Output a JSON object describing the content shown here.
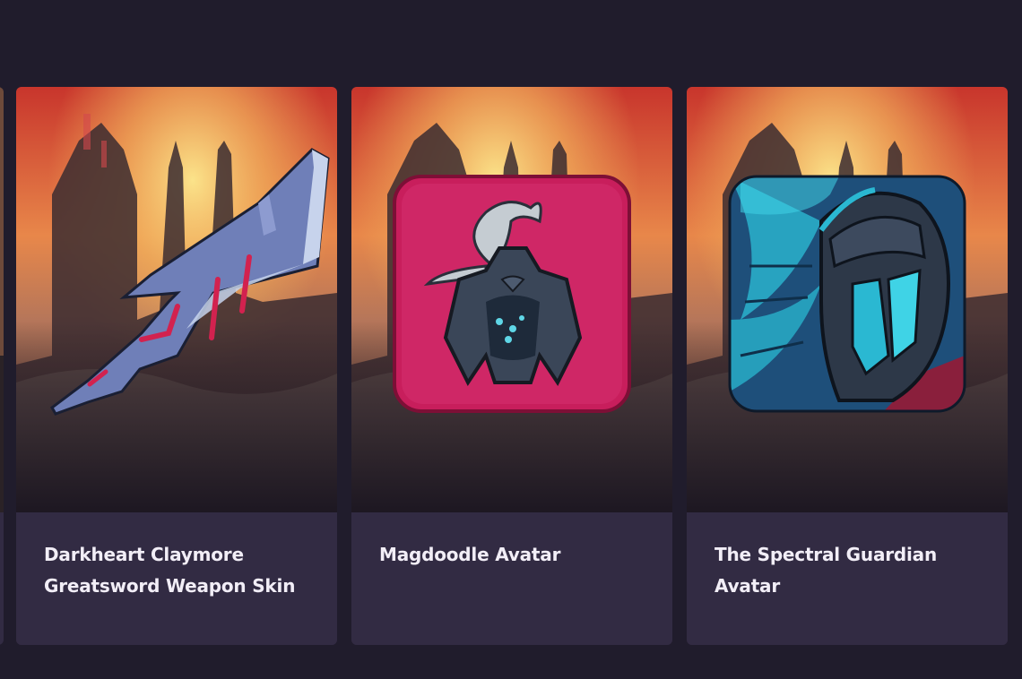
{
  "rewards": {
    "items": [
      {
        "title": "Darkheart Claymore Greatsword Weapon Skin",
        "art_icon": "greatsword-icon",
        "art_colors": {
          "blade": "#6f7fb8",
          "edge": "#c7d3ec",
          "crack": "#d2224f"
        }
      },
      {
        "title": "Magdoodle Avatar",
        "art_icon": "magdoodle-avatar-icon",
        "art_colors": {
          "tile": "#c81e5c",
          "armor": "#3a4658",
          "plume": "#c5ccd2",
          "glow": "#5fd6e6"
        }
      },
      {
        "title": "The Spectral Guardian Avatar",
        "art_icon": "spectral-guardian-avatar-icon",
        "art_colors": {
          "tile": "#1e4f7a",
          "feathers": "#2ab8d2",
          "helm": "#2d3848",
          "accent": "#8a1f3c"
        }
      }
    ]
  },
  "theme": {
    "page_bg": "#201c2c",
    "card_footer_bg": "#322b43",
    "title_color": "#f2eef7",
    "sky_top": "#d9402e",
    "sun_glow": "#f7d774"
  }
}
